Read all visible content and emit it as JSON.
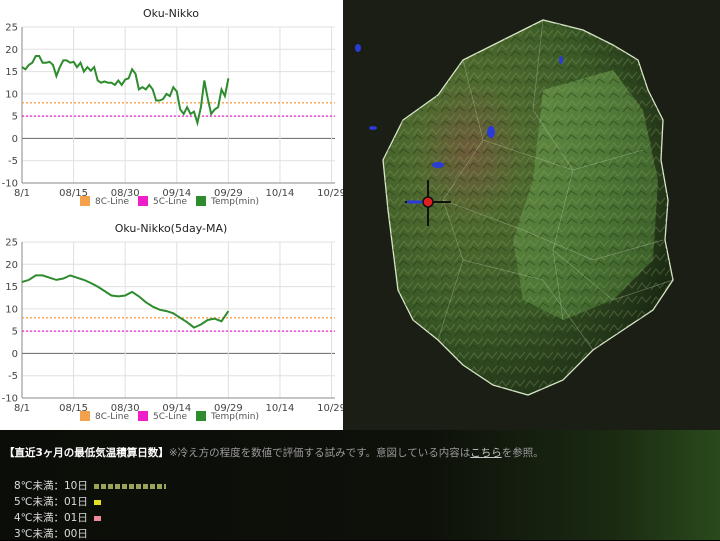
{
  "chart_data": [
    {
      "type": "line",
      "title": "Oku-Nikko",
      "x_ticks": [
        "8/1",
        "08/15",
        "08/30",
        "09/14",
        "09/29",
        "10/14",
        "10/29"
      ],
      "y_ticks": [
        "25",
        "20",
        "15",
        "10",
        "5",
        "0",
        "-5",
        "-10"
      ],
      "xlim": [
        0,
        91
      ],
      "ylim": [
        -10,
        25
      ],
      "legend": [
        "8C-Line",
        "5C-Line",
        "Temp(min)"
      ],
      "legend_position": "bottom",
      "colors": {
        "line8": "#f5a04a",
        "line5": "#ee1fc8",
        "temp": "#2e8b2e"
      },
      "series": [
        {
          "name": "8C-Line",
          "values": [
            [
              0,
              8
            ],
            [
              91,
              8
            ]
          ]
        },
        {
          "name": "5C-Line",
          "values": [
            [
              0,
              5
            ],
            [
              91,
              5
            ]
          ]
        },
        {
          "name": "Temp(min)",
          "values": [
            [
              0,
              16
            ],
            [
              1,
              15.5
            ],
            [
              2,
              16.5
            ],
            [
              3,
              17
            ],
            [
              4,
              18.5
            ],
            [
              5,
              18.5
            ],
            [
              6,
              17
            ],
            [
              7,
              17
            ],
            [
              8,
              17.2
            ],
            [
              9,
              16.5
            ],
            [
              10,
              14
            ],
            [
              11,
              16
            ],
            [
              12,
              17.5
            ],
            [
              13,
              17.5
            ],
            [
              14,
              17
            ],
            [
              15,
              17.2
            ],
            [
              16,
              16
            ],
            [
              17,
              17
            ],
            [
              18,
              15
            ],
            [
              19,
              16
            ],
            [
              20,
              15.2
            ],
            [
              21,
              16
            ],
            [
              22,
              13
            ],
            [
              23,
              12.5
            ],
            [
              24,
              12.8
            ],
            [
              25,
              12.5
            ],
            [
              26,
              12.5
            ],
            [
              27,
              12
            ],
            [
              28,
              13
            ],
            [
              29,
              12
            ],
            [
              30,
              13.2
            ],
            [
              31,
              13.5
            ],
            [
              32,
              15.5
            ],
            [
              33,
              14.5
            ],
            [
              34,
              11
            ],
            [
              35,
              11.5
            ],
            [
              36,
              11
            ],
            [
              37,
              12
            ],
            [
              38,
              11
            ],
            [
              39,
              8.5
            ],
            [
              40,
              8.5
            ],
            [
              41,
              8.8
            ],
            [
              42,
              10
            ],
            [
              43,
              9.5
            ],
            [
              44,
              11.5
            ],
            [
              45,
              10.5
            ],
            [
              46,
              6.5
            ],
            [
              47,
              5.5
            ],
            [
              48,
              7
            ],
            [
              49,
              5.5
            ],
            [
              50,
              6
            ],
            [
              51,
              3.5
            ],
            [
              52,
              7
            ],
            [
              53,
              13
            ],
            [
              54,
              9
            ],
            [
              55,
              5.5
            ],
            [
              56,
              6.5
            ],
            [
              57,
              7
            ],
            [
              58,
              11
            ],
            [
              59,
              9.5
            ],
            [
              60,
              13.5
            ]
          ]
        }
      ]
    },
    {
      "type": "line",
      "title": "Oku-Nikko(5day-MA)",
      "x_ticks": [
        "8/1",
        "08/15",
        "08/30",
        "09/14",
        "09/29",
        "10/14",
        "10/29"
      ],
      "y_ticks": [
        "25",
        "20",
        "15",
        "10",
        "5",
        "0",
        "-5",
        "-10"
      ],
      "xlim": [
        0,
        91
      ],
      "ylim": [
        -10,
        25
      ],
      "legend": [
        "8C-Line",
        "5C-Line",
        "Temp(min)"
      ],
      "legend_position": "bottom",
      "colors": {
        "line8": "#f5a04a",
        "line5": "#ee1fc8",
        "temp": "#2e8b2e"
      },
      "series": [
        {
          "name": "8C-Line",
          "values": [
            [
              0,
              8
            ],
            [
              91,
              8
            ]
          ]
        },
        {
          "name": "5C-Line",
          "values": [
            [
              0,
              5
            ],
            [
              91,
              5
            ]
          ]
        },
        {
          "name": "Temp(min)",
          "values": [
            [
              0,
              16
            ],
            [
              2,
              16.5
            ],
            [
              4,
              17.5
            ],
            [
              6,
              17.5
            ],
            [
              8,
              17
            ],
            [
              10,
              16.5
            ],
            [
              12,
              16.8
            ],
            [
              14,
              17.5
            ],
            [
              16,
              17
            ],
            [
              18,
              16.5
            ],
            [
              20,
              15.8
            ],
            [
              22,
              15
            ],
            [
              24,
              14
            ],
            [
              26,
              13
            ],
            [
              28,
              12.8
            ],
            [
              30,
              13
            ],
            [
              32,
              13.8
            ],
            [
              34,
              12.8
            ],
            [
              36,
              11.5
            ],
            [
              38,
              10.5
            ],
            [
              40,
              9.8
            ],
            [
              42,
              9.5
            ],
            [
              44,
              9
            ],
            [
              46,
              8
            ],
            [
              48,
              7
            ],
            [
              50,
              5.8
            ],
            [
              52,
              6.5
            ],
            [
              54,
              7.5
            ],
            [
              56,
              7.8
            ],
            [
              58,
              7.2
            ],
            [
              60,
              9.5
            ]
          ]
        }
      ]
    }
  ],
  "info": {
    "heading_title": "【直近3ヶ月の最低気温積算日数】",
    "heading_note": "※冷え方の程度を数値で評価する試みです。意図している内容は",
    "heading_link": "こちら",
    "heading_tail": "を参照。",
    "rows": [
      {
        "label": "8℃未満：10日",
        "color": "#9aa35a",
        "bar_fraction": 1.0
      },
      {
        "label": "5℃未満：01日",
        "color": "#e6e020",
        "bar_fraction": 0.1
      },
      {
        "label": "4℃未満：01日",
        "color": "#f08a9a",
        "bar_fraction": 0.1
      },
      {
        "label": "3℃未満：00日",
        "color": "#888888",
        "bar_fraction": 0.0
      }
    ]
  }
}
